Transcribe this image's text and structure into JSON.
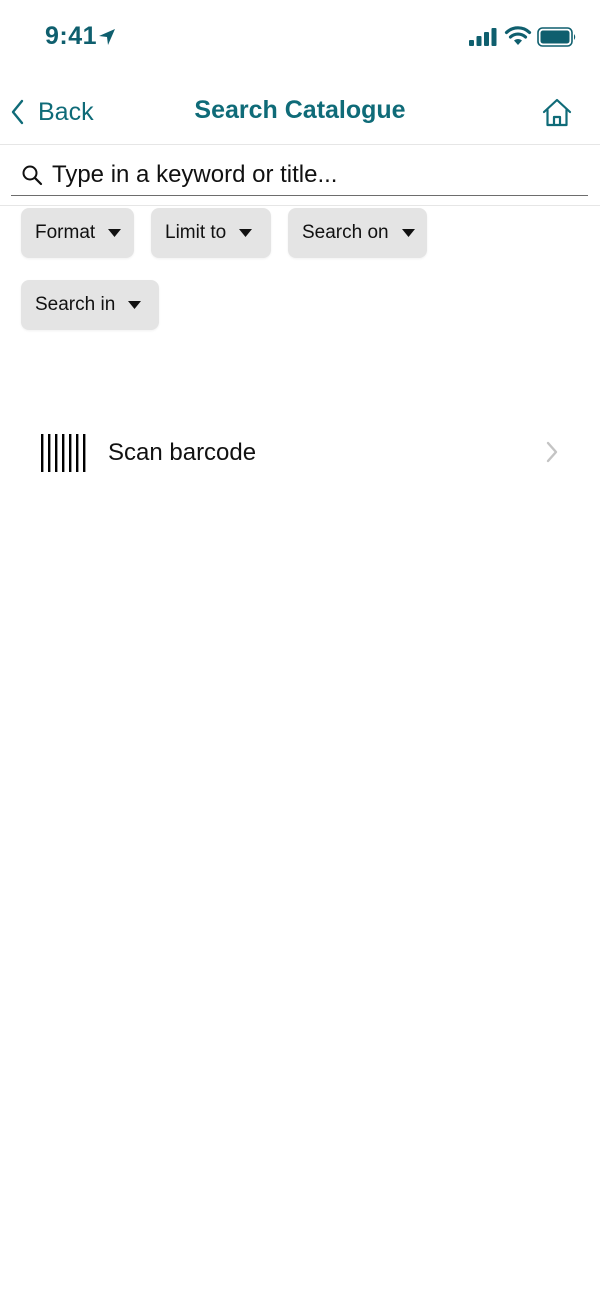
{
  "status_bar": {
    "time": "9:41",
    "icons": [
      "location-arrow-icon",
      "cellular-signal-icon",
      "wifi-icon",
      "battery-icon"
    ]
  },
  "nav": {
    "back_label": "Back",
    "title": "Search Catalogue",
    "home_icon": "home-icon"
  },
  "search": {
    "placeholder": "Type in a keyword or title...",
    "value": ""
  },
  "filters": [
    {
      "label": "Format"
    },
    {
      "label": "Limit to"
    },
    {
      "label": "Search on"
    },
    {
      "label": "Search in"
    }
  ],
  "scan": {
    "label": "Scan barcode",
    "icon": "barcode-icon"
  },
  "colors": {
    "accent": "#0f6b78",
    "time": "#0f5f6e",
    "chip_bg": "#e4e4e4",
    "divider": "#e6e6e6",
    "chevron": "#c4c4c4"
  }
}
